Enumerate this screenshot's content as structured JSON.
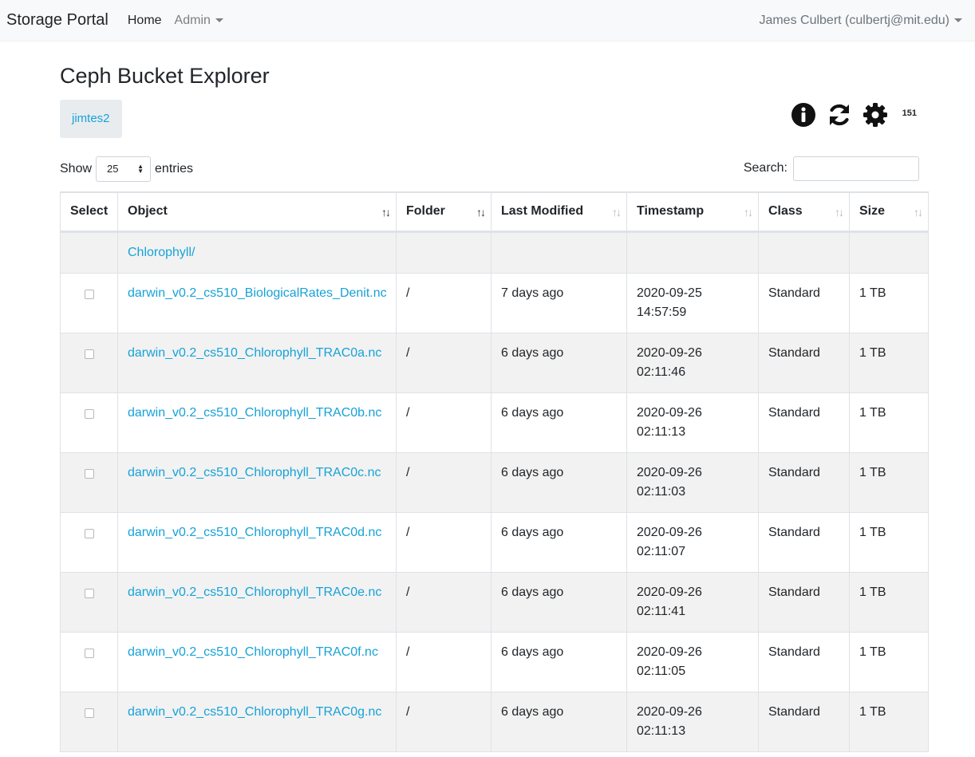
{
  "navbar": {
    "brand": "Storage Portal",
    "home": "Home",
    "admin": "Admin",
    "user": "James Culbert (culbertj@mit.edu)"
  },
  "page": {
    "title": "Ceph Bucket Explorer",
    "bucket": "jimtes2",
    "count": "151",
    "icons": [
      "info-icon",
      "refresh-icon",
      "gear-icon"
    ]
  },
  "controls": {
    "show_label": "Show",
    "page_size": "25",
    "entries_label": "entries",
    "search_label": "Search:",
    "search_value": ""
  },
  "table": {
    "headers": [
      "Select",
      "Object",
      "Folder",
      "Last Modified",
      "Timestamp",
      "Class",
      "Size"
    ],
    "folder_row": "Chlorophyll/",
    "rows": [
      {
        "object": "darwin_v0.2_cs510_BiologicalRates_Denit.nc",
        "folder": "/",
        "modified": "7 days ago",
        "date": "2020-09-25",
        "time": "14:57:59",
        "class": "Standard",
        "size": "1 TB"
      },
      {
        "object": "darwin_v0.2_cs510_Chlorophyll_TRAC0a.nc",
        "folder": "/",
        "modified": "6 days ago",
        "date": "2020-09-26",
        "time": "02:11:46",
        "class": "Standard",
        "size": "1 TB"
      },
      {
        "object": "darwin_v0.2_cs510_Chlorophyll_TRAC0b.nc",
        "folder": "/",
        "modified": "6 days ago",
        "date": "2020-09-26",
        "time": "02:11:13",
        "class": "Standard",
        "size": "1 TB"
      },
      {
        "object": "darwin_v0.2_cs510_Chlorophyll_TRAC0c.nc",
        "folder": "/",
        "modified": "6 days ago",
        "date": "2020-09-26",
        "time": "02:11:03",
        "class": "Standard",
        "size": "1 TB"
      },
      {
        "object": "darwin_v0.2_cs510_Chlorophyll_TRAC0d.nc",
        "folder": "/",
        "modified": "6 days ago",
        "date": "2020-09-26",
        "time": "02:11:07",
        "class": "Standard",
        "size": "1 TB"
      },
      {
        "object": "darwin_v0.2_cs510_Chlorophyll_TRAC0e.nc",
        "folder": "/",
        "modified": "6 days ago",
        "date": "2020-09-26",
        "time": "02:11:41",
        "class": "Standard",
        "size": "1 TB"
      },
      {
        "object": "darwin_v0.2_cs510_Chlorophyll_TRAC0f.nc",
        "folder": "/",
        "modified": "6 days ago",
        "date": "2020-09-26",
        "time": "02:11:05",
        "class": "Standard",
        "size": "1 TB"
      },
      {
        "object": "darwin_v0.2_cs510_Chlorophyll_TRAC0g.nc",
        "folder": "/",
        "modified": "6 days ago",
        "date": "2020-09-26",
        "time": "02:11:13",
        "class": "Standard",
        "size": "1 TB"
      }
    ]
  }
}
